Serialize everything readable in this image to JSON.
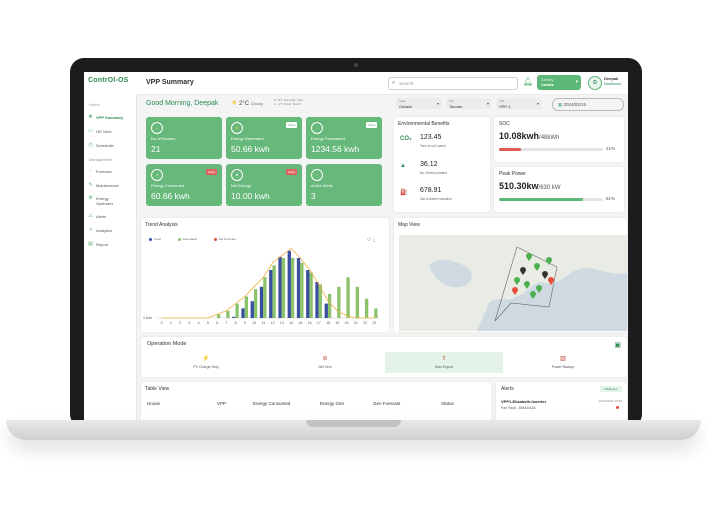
{
  "app": {
    "logo": "ContrOl-OS",
    "page_title": "VPP Summary"
  },
  "sidebar": {
    "home_heading": "Home",
    "management_heading": "Management",
    "items": [
      {
        "label": "VPP Summary",
        "icon": "summary-icon",
        "active": true
      },
      {
        "label": "HD View",
        "icon": "hd-view-icon"
      },
      {
        "label": "Scheduler",
        "icon": "scheduler-icon"
      },
      {
        "label": "Forecast",
        "icon": "forecast-icon"
      },
      {
        "label": "Maintenance",
        "icon": "maintenance-icon"
      },
      {
        "label": "Energy Optimizer",
        "icon": "optimizer-icon"
      },
      {
        "label": "Alerts",
        "icon": "alerts-icon"
      },
      {
        "label": "Analytics",
        "icon": "analytics-icon"
      },
      {
        "label": "Report",
        "icon": "report-icon"
      }
    ]
  },
  "header": {
    "search_placeholder": "Search",
    "country_caption": "Country",
    "country_value": "Canada",
    "user_initial": "D",
    "user_name": "Deepak",
    "user_role": "Dashboard"
  },
  "greeting": {
    "text": "Good Morning, Deepak",
    "temperature": "2°C",
    "condition": "Cloudy",
    "stats": [
      "H: 8°C  Humidity: 11%",
      "L: -1°C  Wind: 5km/h"
    ]
  },
  "filters": [
    {
      "caption": "State",
      "value": "Ontario"
    },
    {
      "caption": "City",
      "value": "Toronto"
    },
    {
      "caption": "VPP",
      "value": "VPP-1"
    }
  ],
  "date": "2024/02/15",
  "tiles": [
    {
      "label": "No of Houses",
      "value": "21"
    },
    {
      "label": "Energy Generated",
      "value": "50.66 kwh",
      "badge": "Today",
      "badge_color": "#ffffff"
    },
    {
      "label": "Energy Forecasted",
      "value": "1234.56 kwh",
      "badge": "Today",
      "badge_color": "#ffffff"
    },
    {
      "label": "Energy Consumed",
      "value": "60.66 kwh",
      "badge": "Today",
      "badge_color": "#e06060"
    },
    {
      "label": "Net Energy",
      "value": "10.00 kwh",
      "badge": "Today",
      "badge_color": "#e06060"
    },
    {
      "label": "Active Alerts",
      "value": "3"
    }
  ],
  "environmental": {
    "title": "Environmental Benefits",
    "rows": [
      {
        "icon": "co2-icon",
        "glyph": "CO₂",
        "value": "123.45",
        "label": "Tons of co2 saved"
      },
      {
        "icon": "tree-icon",
        "glyph": "▲",
        "value": "36.12",
        "label": "No of trees planted"
      },
      {
        "icon": "fuel-icon",
        "glyph": "⛽",
        "value": "678.91",
        "label": "Gal of diesel reduction"
      }
    ]
  },
  "soc": {
    "title": "SOC",
    "value": "10.08kwh",
    "unit": "/48kWh",
    "percent_text": "21%",
    "percent": 21,
    "color": "#e05a4f"
  },
  "peak": {
    "title": "Peak Power",
    "value": "510.30kw",
    "unit": "/630 kW",
    "percent_text": "81%",
    "percent": 81,
    "color": "#5cb877"
  },
  "trend": {
    "title": "Trend Analysis",
    "legend": [
      {
        "label": "Load",
        "color": "#3a4ea0"
      },
      {
        "label": "Generated",
        "color": "#8cc26a"
      },
      {
        "label": "Net Forecast",
        "color": "#e8503a"
      }
    ]
  },
  "chart_data": {
    "type": "bar",
    "title": "Trend Analysis",
    "x": [
      "0",
      "1",
      "2",
      "3",
      "4",
      "5",
      "6",
      "7",
      "8",
      "9",
      "10",
      "11",
      "12",
      "13",
      "14",
      "15",
      "16",
      "17",
      "18",
      "19",
      "20",
      "21",
      "22",
      "23"
    ],
    "xlabel": "",
    "ylabel": "",
    "y_tick": "0 kwh",
    "series": [
      {
        "name": "Load",
        "type": "bar",
        "color": "#3a4ea0",
        "values": [
          0,
          0,
          0,
          0,
          0,
          0,
          0,
          0,
          1,
          8,
          14,
          26,
          40,
          51,
          56,
          50,
          40,
          30,
          12,
          0,
          0,
          0,
          0,
          0
        ]
      },
      {
        "name": "Generated",
        "type": "bar",
        "color": "#8cc26a",
        "values": [
          0,
          0,
          0,
          0,
          0,
          0,
          3,
          6,
          12,
          18,
          24,
          34,
          44,
          50,
          50,
          46,
          38,
          28,
          20,
          26,
          34,
          26,
          16,
          8
        ]
      },
      {
        "name": "Net Forecast",
        "type": "line",
        "color": "#f0b040",
        "values": [
          0,
          0,
          0,
          0,
          0,
          0,
          3,
          6,
          12,
          18,
          26,
          34,
          46,
          52,
          58,
          50,
          40,
          28,
          14,
          6,
          2,
          0,
          0,
          0
        ]
      }
    ],
    "ylim": [
      0,
      60
    ]
  },
  "map": {
    "title": "Map View",
    "markers": [
      {
        "color": "#4caf50"
      },
      {
        "color": "#4caf50"
      },
      {
        "color": "#4caf50"
      },
      {
        "color": "#333333"
      },
      {
        "color": "#333333"
      },
      {
        "color": "#4caf50"
      },
      {
        "color": "#4caf50"
      },
      {
        "color": "#4caf50"
      },
      {
        "color": "#e74c3c"
      },
      {
        "color": "#4caf50"
      },
      {
        "color": "#e74c3c"
      }
    ]
  },
  "operation": {
    "title": "Operation Mode",
    "options": [
      {
        "label": "PV Charge Only",
        "icon": "pv-charge-icon"
      },
      {
        "label": "Net Zero",
        "icon": "net-zero-icon"
      },
      {
        "label": "Max Export",
        "icon": "max-export-icon",
        "selected": true
      },
      {
        "label": "Power Backup",
        "icon": "power-backup-icon"
      }
    ]
  },
  "table": {
    "title": "Table View",
    "headers": [
      "House",
      "VPP",
      "Energy Consumed",
      "Energy Gen",
      "Gen Forecast",
      "Status"
    ]
  },
  "alerts": {
    "title": "Alerts",
    "view_all": "VIEW ALL",
    "items": [
      {
        "name": "VPP1-Elizabeth-Inverter",
        "time": "2024/02/02 10:30",
        "desc": "Fan Fault - DMADA18"
      }
    ]
  }
}
